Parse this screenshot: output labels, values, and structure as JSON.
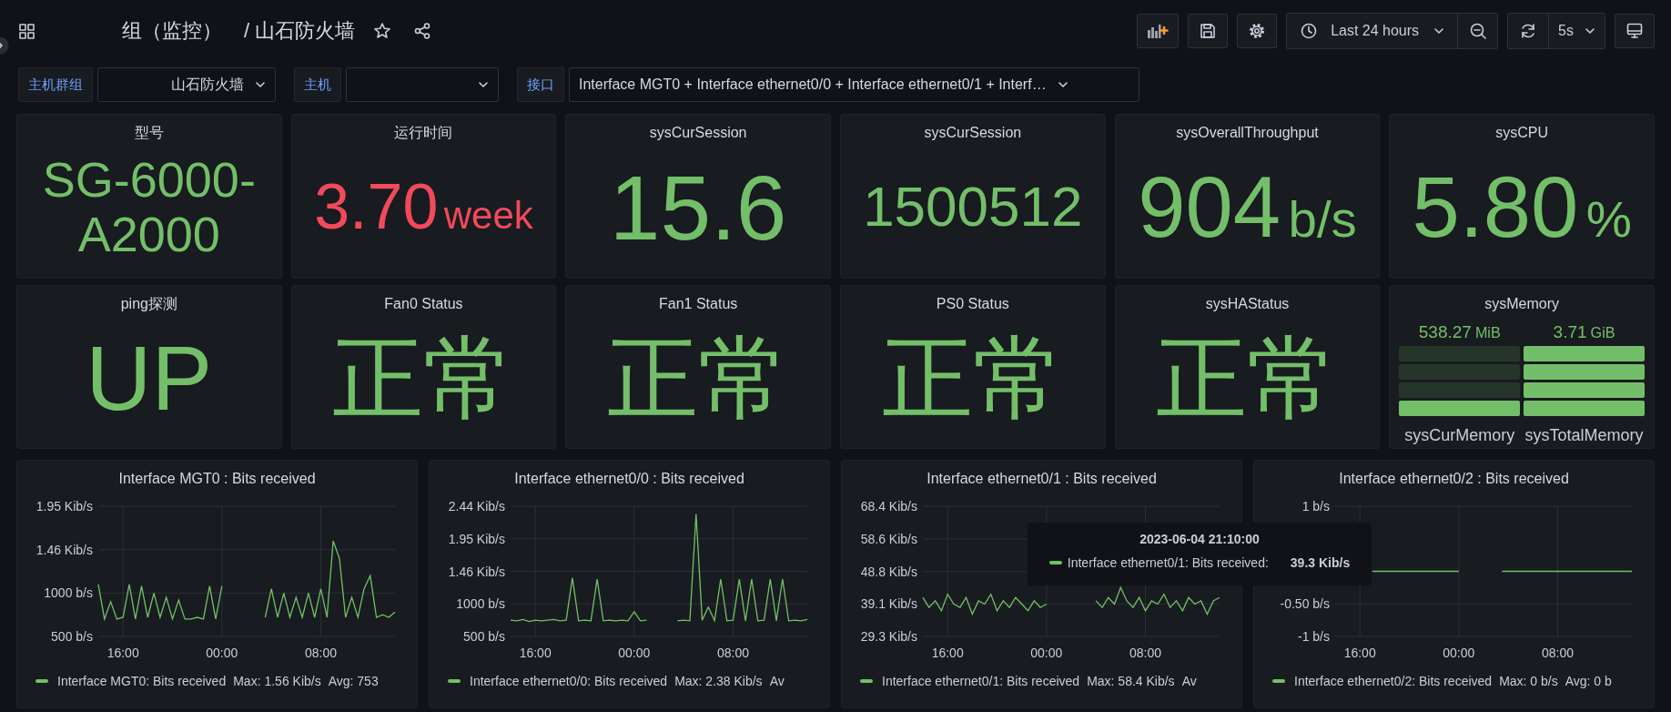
{
  "header": {
    "breadcrumb": "组（监控）",
    "title": "/ 山石防火墙",
    "time_range": "Last 24 hours",
    "refresh_interval": "5s"
  },
  "variables": [
    {
      "label": "主机群组",
      "value": "山石防火墙"
    },
    {
      "label": "主机"
    },
    {
      "label": "接口",
      "value": "Interface MGT0 + Interface ethernet0/0 + Interface ethernet0/1 + Interf…"
    }
  ],
  "stat_panels": [
    {
      "kind": "stat",
      "title": "型号",
      "value": "SG-6000-A2000",
      "color": "#73bf69"
    },
    {
      "kind": "stat",
      "title": "运行时间",
      "value": "3.70",
      "unit": "week",
      "color": "#f2495c"
    },
    {
      "kind": "stat",
      "title": "sysCurSession",
      "value": "15.6",
      "color": "#73bf69"
    },
    {
      "kind": "stat",
      "title": "sysCurSession",
      "value": "1500512",
      "color": "#73bf69"
    },
    {
      "kind": "stat",
      "title": "sysOverallThroughput",
      "value": "904",
      "unit": "b/s",
      "color": "#73bf69"
    },
    {
      "kind": "stat",
      "title": "sysCPU",
      "value": "5.80",
      "unit": "%",
      "color": "#73bf69"
    },
    {
      "kind": "stat",
      "title": "ping探测",
      "value": "UP",
      "color": "#73bf69"
    },
    {
      "kind": "stat",
      "title": "Fan0 Status",
      "value": "正常",
      "color": "#73bf69"
    },
    {
      "kind": "stat",
      "title": "Fan1 Status",
      "value": "正常",
      "color": "#73bf69"
    },
    {
      "kind": "stat",
      "title": "PS0 Status",
      "value": "正常",
      "color": "#73bf69"
    },
    {
      "kind": "stat",
      "title": "sysHAStatus",
      "value": "正常",
      "color": "#73bf69"
    },
    {
      "kind": "bargauge",
      "title": "sysMemory",
      "gauges": [
        {
          "value": "538.27",
          "unit": "MiB",
          "label": "sysCurMemory",
          "segments": [
            {
              "lit": false
            },
            {
              "lit": false
            },
            {
              "lit": false
            },
            {
              "lit": true
            }
          ]
        },
        {
          "value": "3.71",
          "unit": "GiB",
          "label": "sysTotalMemory",
          "segments": [
            {
              "lit": true
            },
            {
              "lit": true
            },
            {
              "lit": true
            },
            {
              "lit": true
            }
          ]
        }
      ]
    }
  ],
  "graph_panels": [
    {
      "title": "Interface MGT0 : Bits received",
      "stats": [
        "Max: 1.56 Kib/s",
        "Avg: 753"
      ],
      "upper_axis_labels": [
        "1.95 Kib/s",
        "1.46 Kib/s"
      ],
      "chart_data": {
        "type": "line",
        "grid": true,
        "categories": [
          null,
          null,
          null,
          null,
          "16:00",
          null,
          null,
          null,
          null,
          null,
          null,
          null,
          null,
          null,
          null,
          null,
          null,
          null,
          null,
          null,
          "00:00",
          null,
          null,
          null,
          null,
          null,
          null,
          null,
          null,
          null,
          null,
          null,
          null,
          null,
          null,
          null,
          "08:00",
          null,
          null,
          null,
          null,
          null,
          null,
          null,
          null,
          null,
          null,
          null,
          null
        ],
        "ylim": [
          500,
          2000
        ],
        "yticks": [
          {
            "value": 500,
            "label": "500 b/s"
          },
          {
            "value": 1000,
            "label": "1000 b/s"
          }
        ],
        "series": [
          {
            "name": "Interface MGT0: Bits received",
            "color": "#73bf69",
            "values": [
              1100,
              700,
              900,
              700,
              720,
              1100,
              700,
              1080,
              720,
              1000,
              720,
              950,
              700,
              920,
              700,
              700,
              720,
              700,
              1080,
              700,
              1080,
              null,
              null,
              null,
              null,
              null,
              null,
              720,
              1050,
              720,
              1000,
              720,
              950,
              720,
              1000,
              720,
              1050,
              720,
              1600,
              1400,
              720,
              950,
              720,
              1050,
              1200,
              720,
              750,
              720,
              780
            ]
          }
        ]
      }
    },
    {
      "title": "Interface ethernet0/0 : Bits received",
      "stats": [
        "Max: 2.38 Kib/s",
        "Av"
      ],
      "upper_axis_labels": [
        "2.44 Kib/s",
        "1.95 Kib/s",
        "1.46 Kib/s"
      ],
      "chart_data": {
        "type": "line",
        "grid": true,
        "categories": [
          null,
          null,
          null,
          null,
          "16:00",
          null,
          null,
          null,
          null,
          null,
          null,
          null,
          null,
          null,
          null,
          null,
          null,
          null,
          null,
          null,
          "00:00",
          null,
          null,
          null,
          null,
          null,
          null,
          null,
          null,
          null,
          null,
          null,
          null,
          null,
          null,
          null,
          "08:00",
          null,
          null,
          null,
          null,
          null,
          null,
          null,
          null,
          null,
          null,
          null,
          null
        ],
        "ylim": [
          500,
          2500
        ],
        "yticks": [
          {
            "value": 500,
            "label": "500 b/s"
          },
          {
            "value": 1000,
            "label": "1000 b/s"
          }
        ],
        "series": [
          {
            "name": "Interface ethernet0/0: Bits received",
            "color": "#73bf69",
            "values": [
              750,
              740,
              760,
              730,
              750,
              740,
              750,
              760,
              740,
              750,
              1400,
              740,
              750,
              740,
              1380,
              740,
              750,
              740,
              750,
              740,
              880,
              740,
              750,
              null,
              null,
              null,
              null,
              740,
              750,
              740,
              2380,
              750,
              950,
              740,
              1380,
              740,
              750,
              1380,
              740,
              1380,
              740,
              750,
              1380,
              740,
              1380,
              740,
              750,
              740,
              760
            ]
          }
        ]
      }
    },
    {
      "title": "Interface ethernet0/1 : Bits received",
      "stats": [
        "Max: 58.4 Kib/s",
        "Av"
      ],
      "chart_data": {
        "type": "line",
        "grid": true,
        "categories": [
          null,
          null,
          null,
          null,
          "16:00",
          null,
          null,
          null,
          null,
          null,
          null,
          null,
          null,
          null,
          null,
          null,
          null,
          null,
          null,
          null,
          "00:00",
          null,
          null,
          null,
          null,
          null,
          null,
          null,
          null,
          null,
          null,
          null,
          null,
          null,
          null,
          null,
          "08:00",
          null,
          null,
          null,
          null,
          null,
          null,
          null,
          null,
          null,
          null,
          null,
          null
        ],
        "ylim": [
          29.3,
          68.4
        ],
        "yticks": [
          {
            "value": 29.3,
            "label": "29.3 Kib/s"
          },
          {
            "value": 39.1,
            "label": "39.1 Kib/s"
          },
          {
            "value": 48.8,
            "label": "48.8 Kib/s"
          },
          {
            "value": 58.6,
            "label": "58.6 Kib/s"
          },
          {
            "value": 68.4,
            "label": "68.4 Kib/s"
          }
        ],
        "series": [
          {
            "name": "Interface ethernet0/1: Bits received",
            "color": "#73bf69",
            "values": [
              41,
              38,
              40,
              37,
              42,
              39,
              38,
              41,
              36,
              40,
              39,
              42,
              37,
              40,
              38,
              41,
              39,
              37,
              40,
              38,
              39,
              null,
              null,
              null,
              null,
              null,
              null,
              null,
              40,
              38,
              41,
              39,
              44,
              40,
              38,
              41,
              37,
              40,
              39,
              42,
              38,
              40,
              37,
              41,
              39,
              40,
              36,
              40,
              41
            ]
          }
        ]
      }
    },
    {
      "title": "Interface ethernet0/2 : Bits received",
      "stats": [
        "Max: 0 b/s",
        "Avg: 0 b"
      ],
      "chart_data": {
        "type": "line",
        "grid": true,
        "categories": [
          null,
          null,
          null,
          null,
          "16:00",
          null,
          null,
          null,
          null,
          null,
          null,
          null,
          null,
          null,
          null,
          null,
          null,
          null,
          null,
          null,
          "00:00",
          null,
          null,
          null,
          null,
          null,
          null,
          null,
          null,
          null,
          null,
          null,
          null,
          null,
          null,
          null,
          "08:00",
          null,
          null,
          null,
          null,
          null,
          null,
          null,
          null,
          null,
          null,
          null,
          null
        ],
        "ylim": [
          -1,
          1
        ],
        "yticks": [
          {
            "value": -1,
            "label": "-1 b/s"
          },
          {
            "value": -0.5,
            "label": "-0.50 b/s"
          },
          {
            "value": 1,
            "label": "1 b/s"
          }
        ],
        "series": [
          {
            "name": "Interface ethernet0/2: Bits received",
            "color": "#73bf69",
            "values": [
              null,
              null,
              null,
              null,
              null,
              null,
              0,
              0,
              0,
              0,
              0,
              0,
              0,
              0,
              0,
              0,
              0,
              0,
              0,
              0,
              0,
              null,
              null,
              null,
              null,
              null,
              null,
              0,
              0,
              0,
              0,
              0,
              0,
              0,
              0,
              0,
              0,
              0,
              0,
              0,
              0,
              0,
              0,
              0,
              0,
              0,
              0,
              0,
              0
            ]
          }
        ]
      }
    }
  ],
  "tooltip": {
    "time": "2023-06-04 21:10:00",
    "series": "Interface ethernet0/1: Bits received:",
    "value": "39.3 Kib/s",
    "color": "#73bf69"
  }
}
